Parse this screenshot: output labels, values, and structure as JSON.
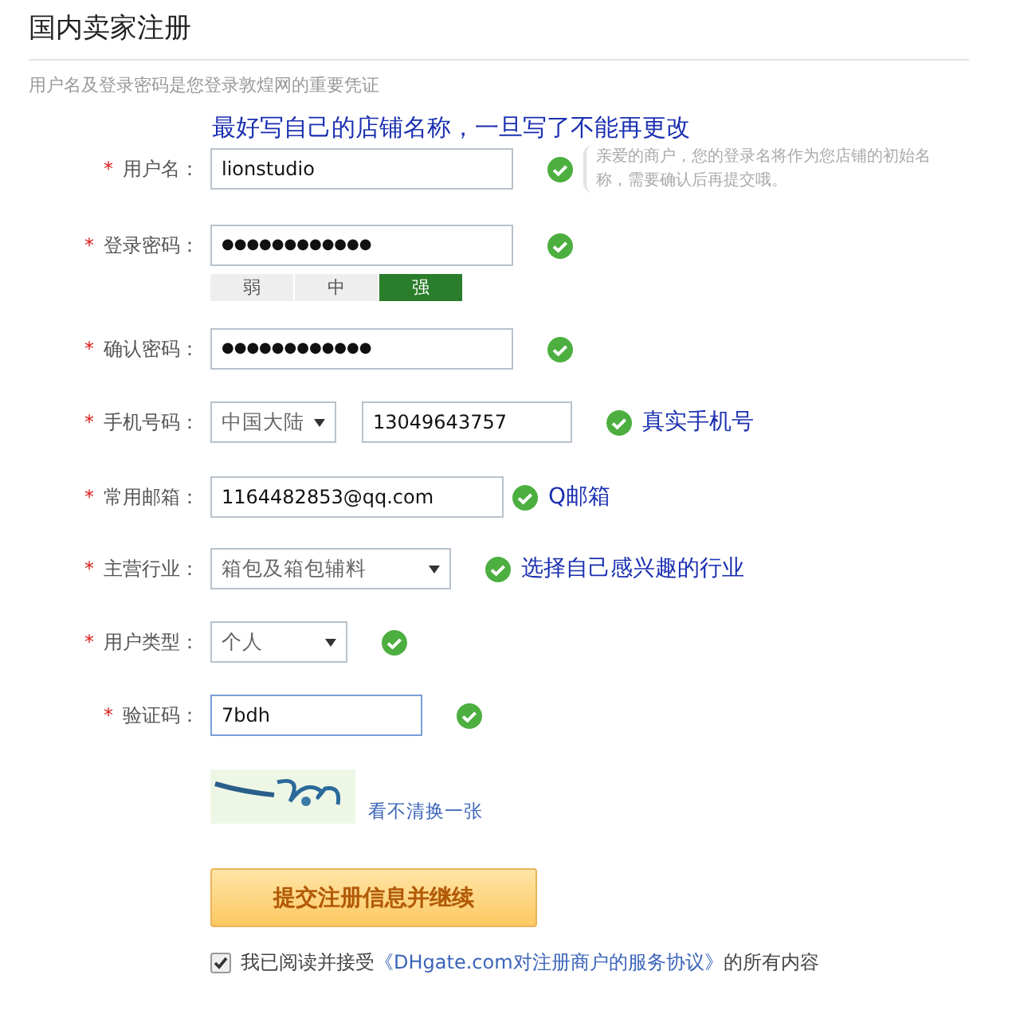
{
  "title": "国内卖家注册",
  "subtitle": "用户名及登录密码是您登录敦煌网的重要凭证",
  "fields": [
    {
      "kind": "text",
      "mark": "*",
      "label": "用户名：",
      "value": "lionstudio",
      "valid": true,
      "annotation": "最好写自己的店铺名称，一旦写了不能再更改",
      "hint": "亲爱的商户，您的登录名将作为您店铺的初始名称，需要确认后再提交哦。"
    },
    {
      "kind": "password",
      "mark": "*",
      "label": "登录密码：",
      "value": "●●●●●●●●●●●●",
      "valid": true,
      "strength": [
        {
          "label": "弱",
          "selected": false
        },
        {
          "label": "中",
          "selected": false
        },
        {
          "label": "强",
          "selected": true
        }
      ]
    },
    {
      "kind": "password",
      "mark": "*",
      "label": "确认密码：",
      "value": "●●●●●●●●●●●●",
      "valid": true
    },
    {
      "kind": "phone",
      "mark": "*",
      "label": "手机号码：",
      "region": "中国大陆",
      "value": "13049643757",
      "valid": true,
      "note": "真实手机号"
    },
    {
      "kind": "text",
      "mark": "*",
      "label": "常用邮箱：",
      "value": "1164482853@qq.com",
      "valid": true,
      "note": "Q邮箱"
    },
    {
      "kind": "select",
      "mark": "*",
      "label": "主营行业：",
      "value": "箱包及箱包辅料",
      "valid": true,
      "note": "选择自己感兴趣的行业"
    },
    {
      "kind": "select",
      "mark": "*",
      "label": "用户类型：",
      "value": "个人",
      "valid": true
    },
    {
      "kind": "captcha",
      "mark": "*",
      "label": "验证码：",
      "value": "7bdh",
      "valid": true,
      "refresh": "看不清换一张"
    }
  ],
  "submit": "提交注册信息并继续",
  "agreement": {
    "checked": true,
    "before": "我已阅读并接受",
    "link": "《DHgate.com对注册商户的服务协议》",
    "after": "的所有内容"
  }
}
